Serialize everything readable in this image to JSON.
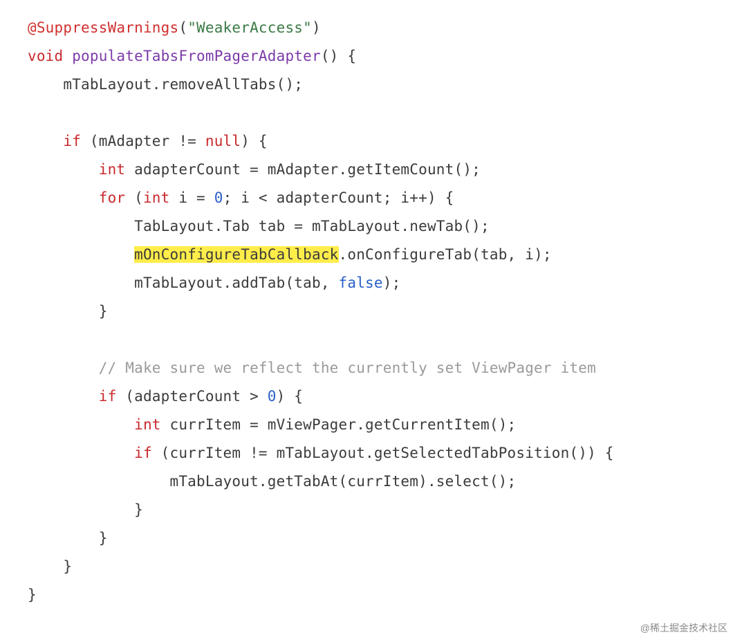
{
  "watermark": "@稀土掘金技术社区",
  "code": {
    "line1": {
      "annotation": "@SuppressWarnings",
      "paren_open": "(",
      "string": "\"WeakerAccess\"",
      "paren_close": ")"
    },
    "line2": {
      "kw_void": "void",
      "method": " populateTabsFromPagerAdapter",
      "rest": "() {"
    },
    "line3": "    mTabLayout.removeAllTabs();",
    "line4": "",
    "line5": {
      "indent": "    ",
      "kw_if": "if",
      "rest1": " (mAdapter != ",
      "kw_null": "null",
      "rest2": ") {"
    },
    "line6": {
      "indent": "        ",
      "kw_int": "int",
      "rest": " adapterCount = mAdapter.getItemCount();"
    },
    "line7": {
      "indent": "        ",
      "kw_for": "for",
      "rest1": " (",
      "kw_int": "int",
      "rest2": " i = ",
      "num0": "0",
      "rest3": "; i < adapterCount; i++) {"
    },
    "line8": "            TabLayout.Tab tab = mTabLayout.newTab();",
    "line9": {
      "indent": "            ",
      "hl": "mOnConfigureTabCallback",
      "rest": ".onConfigureTab(tab, i);"
    },
    "line10": {
      "indent": "            mTabLayout.addTab(tab, ",
      "kw_false": "false",
      "rest": ");"
    },
    "line11": "        }",
    "line12": "",
    "line13": {
      "indent": "        ",
      "comment": "// Make sure we reflect the currently set ViewPager item"
    },
    "line14": {
      "indent": "        ",
      "kw_if": "if",
      "rest1": " (adapterCount > ",
      "num0": "0",
      "rest2": ") {"
    },
    "line15": {
      "indent": "            ",
      "kw_int": "int",
      "rest": " currItem = mViewPager.getCurrentItem();"
    },
    "line16": {
      "indent": "            ",
      "kw_if": "if",
      "rest": " (currItem != mTabLayout.getSelectedTabPosition()) {"
    },
    "line17": "                mTabLayout.getTabAt(currItem).select();",
    "line18": "            }",
    "line19": "        }",
    "line20": "    }",
    "line21": "}"
  }
}
